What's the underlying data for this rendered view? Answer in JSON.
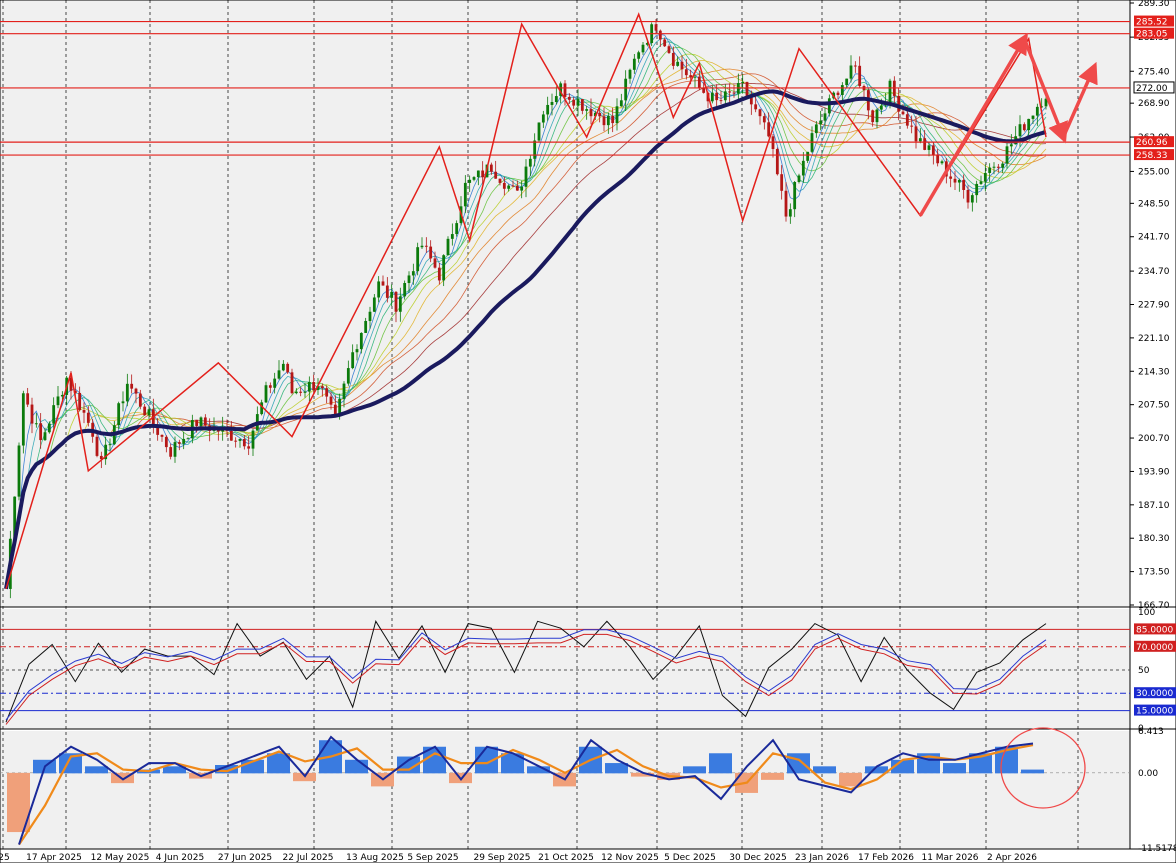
{
  "colors": {
    "background": "#f0f0f0",
    "bull_candle": "#0b7a0b",
    "bear_candle": "#b51717",
    "main_ma": "#1a1a5e",
    "level_line": "#e3201b",
    "pattern_line": "#e3201b",
    "forecast_arrow": "#ef4a4a",
    "macd_pos": "#3a7be0",
    "macd_neg": "#f0a07a",
    "macd_line": "#1a2a9a",
    "signal_line": "#f08a1a",
    "stoch_k": "#111111",
    "stoch_d": "#2a3ad0",
    "stoch_x": "#d02020"
  },
  "chart_data": [
    {
      "type": "candlestick",
      "panel": "price",
      "x_axis_type": "date",
      "time_labels": [
        "25",
        "17 Apr 2025",
        "12 May 2025",
        "4 Jun 2025",
        "27 Jun 2025",
        "22 Jul 2025",
        "13 Aug 2025",
        "5 Sep 2025",
        "29 Sep 2025",
        "21 Oct 2025",
        "12 Nov 2025",
        "5 Dec 2025",
        "30 Dec 2025",
        "23 Jan 2026",
        "17 Feb 2026",
        "11 Mar 2026",
        "2 Apr 2026"
      ],
      "y_ticks": [
        "289.30",
        "282.35",
        "275.40",
        "268.90",
        "262.00",
        "255.00",
        "248.50",
        "241.70",
        "234.70",
        "227.90",
        "221.10",
        "214.30",
        "207.50",
        "200.70",
        "193.90",
        "187.10",
        "180.30",
        "173.50",
        "166.70"
      ],
      "ylim": [
        166.7,
        289.3
      ],
      "price_path": [
        [
          0,
          170
        ],
        [
          4,
          210
        ],
        [
          8,
          200
        ],
        [
          14,
          213
        ],
        [
          20,
          202
        ],
        [
          22,
          195
        ],
        [
          28,
          212
        ],
        [
          33,
          205
        ],
        [
          38,
          198
        ],
        [
          44,
          204
        ],
        [
          50,
          202
        ],
        [
          56,
          200
        ],
        [
          60,
          210
        ],
        [
          64,
          216
        ],
        [
          66,
          210
        ],
        [
          72,
          212
        ],
        [
          76,
          204
        ],
        [
          80,
          218
        ],
        [
          86,
          232
        ],
        [
          90,
          228
        ],
        [
          96,
          240
        ],
        [
          100,
          234
        ],
        [
          106,
          252
        ],
        [
          112,
          256
        ],
        [
          118,
          250
        ],
        [
          124,
          268
        ],
        [
          128,
          272
        ],
        [
          134,
          268
        ],
        [
          140,
          265
        ],
        [
          146,
          280
        ],
        [
          150,
          285
        ],
        [
          154,
          278
        ],
        [
          160,
          272
        ],
        [
          164,
          269
        ],
        [
          170,
          272
        ],
        [
          176,
          262
        ],
        [
          180,
          246
        ],
        [
          186,
          262
        ],
        [
          192,
          272
        ],
        [
          196,
          276
        ],
        [
          200,
          266
        ],
        [
          204,
          272
        ],
        [
          210,
          262
        ],
        [
          216,
          256
        ],
        [
          222,
          250
        ],
        [
          226,
          255
        ],
        [
          230,
          258
        ],
        [
          236,
          266
        ],
        [
          240,
          271
        ]
      ],
      "levels": [
        {
          "label": "285.52",
          "value": 285.52
        },
        {
          "label": "283.05",
          "value": 283.05
        },
        {
          "label": "272.00",
          "value": 272.0
        },
        {
          "label": "260.96",
          "value": 260.96
        },
        {
          "label": "258.33",
          "value": 258.33
        }
      ],
      "zigzag": [
        [
          0,
          170
        ],
        [
          15,
          214
        ],
        [
          19,
          194
        ],
        [
          49,
          216
        ],
        [
          66,
          201
        ],
        [
          100,
          260
        ],
        [
          107,
          241
        ],
        [
          119,
          285
        ],
        [
          134,
          262
        ],
        [
          146,
          287
        ],
        [
          154,
          266
        ],
        [
          160,
          277
        ],
        [
          170,
          245
        ],
        [
          183,
          280
        ],
        [
          211,
          246
        ],
        [
          236,
          282
        ],
        [
          240,
          262
        ]
      ],
      "forecast_path": [
        [
          211,
          246
        ],
        [
          235,
          282
        ],
        [
          244,
          262
        ],
        [
          251,
          276
        ]
      ]
    },
    {
      "type": "line",
      "panel": "stochastic",
      "ylim": [
        0,
        100
      ],
      "y_ticks": [
        "100",
        "85.0000",
        "70.0000",
        "50",
        "30.0000",
        "15.0000",
        "0"
      ],
      "levels": [
        85,
        70,
        50,
        30,
        15
      ],
      "series": [
        {
          "values": [
            5,
            55,
            72,
            40,
            73,
            48,
            68,
            62,
            62,
            46,
            90,
            62,
            74,
            42,
            62,
            18,
            92,
            60,
            88,
            48,
            90,
            86,
            48,
            92,
            86,
            70,
            92,
            70,
            42,
            62,
            88,
            28,
            10,
            52,
            68,
            90,
            80,
            40,
            78,
            50,
            30,
            16,
            48,
            56,
            76,
            90
          ]
        }
      ]
    },
    {
      "type": "bar",
      "panel": "macd",
      "ylim": [
        -11.5178,
        6.413
      ],
      "y_ticks": [
        "6.413",
        "0.00",
        "-11.5178"
      ],
      "histogram": [
        -9,
        2,
        3,
        1,
        -1.5,
        0.5,
        1,
        -0.8,
        1.2,
        2,
        3,
        -1.2,
        5,
        2,
        -2,
        2.5,
        4,
        -1.5,
        4,
        3,
        1,
        -2,
        4,
        1.5,
        -0.5,
        -1,
        1,
        3,
        -3,
        -1,
        3,
        1,
        -2,
        1,
        2,
        3,
        1.5,
        3,
        4,
        0.5
      ],
      "macd_values": [
        -11,
        1,
        4,
        2,
        -1,
        1.5,
        1.5,
        -0.5,
        1,
        2.5,
        4,
        -0.5,
        5.5,
        2,
        -1,
        2,
        4,
        -1,
        4,
        3,
        1,
        -1,
        5,
        2,
        0,
        -1,
        -0.5,
        -4,
        1,
        5,
        -1,
        -2,
        -3,
        1,
        3,
        2,
        2,
        3,
        4,
        4.5
      ]
    }
  ]
}
